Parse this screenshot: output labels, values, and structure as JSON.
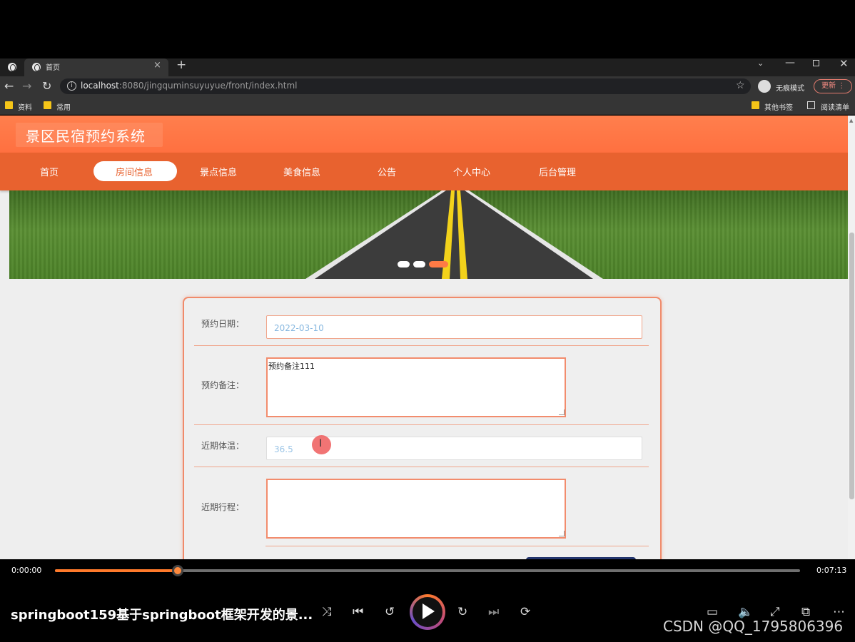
{
  "browser": {
    "tab_title": "首页",
    "tab_close": "×",
    "new_tab": "+",
    "tab_search": "⌄",
    "min": "—",
    "close": "✕",
    "url_host": "localhost",
    "url_rest": ":8080/jingquminsuyuyue/front/index.html",
    "star": "☆",
    "incognito_label": "无痕模式",
    "update_label": "更新",
    "update_more": "⋮",
    "bookmarks": [
      "资料",
      "常用"
    ],
    "other_bookmarks": "其他书签",
    "reading_list": "阅读清单"
  },
  "site": {
    "title": "景区民宿预约系统",
    "nav": [
      "首页",
      "房间信息",
      "景点信息",
      "美食信息",
      "公告",
      "个人中心",
      "后台管理"
    ],
    "active_nav": "房间信息",
    "carousel": {
      "count": 3,
      "active_index": 2
    }
  },
  "form": {
    "date_label": "预约日期：",
    "date_value": "2022-03-10",
    "remark_label": "预约备注：",
    "remark_value": "预约备注111",
    "temp_label": "近期体温：",
    "temp_value": "36.5",
    "trip_label": "近期行程：",
    "trip_value": ""
  },
  "player": {
    "current_time": "0:00:00",
    "total_time": "0:07:13",
    "progress": 0.165,
    "title": "springboot159基于springboot框架开发的景...",
    "controls": {
      "shuffle": "⤨",
      "prev": "⏮",
      "back10": "↺",
      "fwd30": "↻",
      "next": "⏭",
      "repeat": "⟳",
      "subtitles": "▭",
      "volume": "🔈",
      "fullscreen": "⤢",
      "pip": "⧉",
      "more": "⋯"
    },
    "watermark": "CSDN @QQ_1795806396"
  },
  "colors": {
    "header": "#ff7a45",
    "nav": "#e8622f",
    "accent_border": "#f08a6a",
    "progress": "#ff7a2b"
  }
}
